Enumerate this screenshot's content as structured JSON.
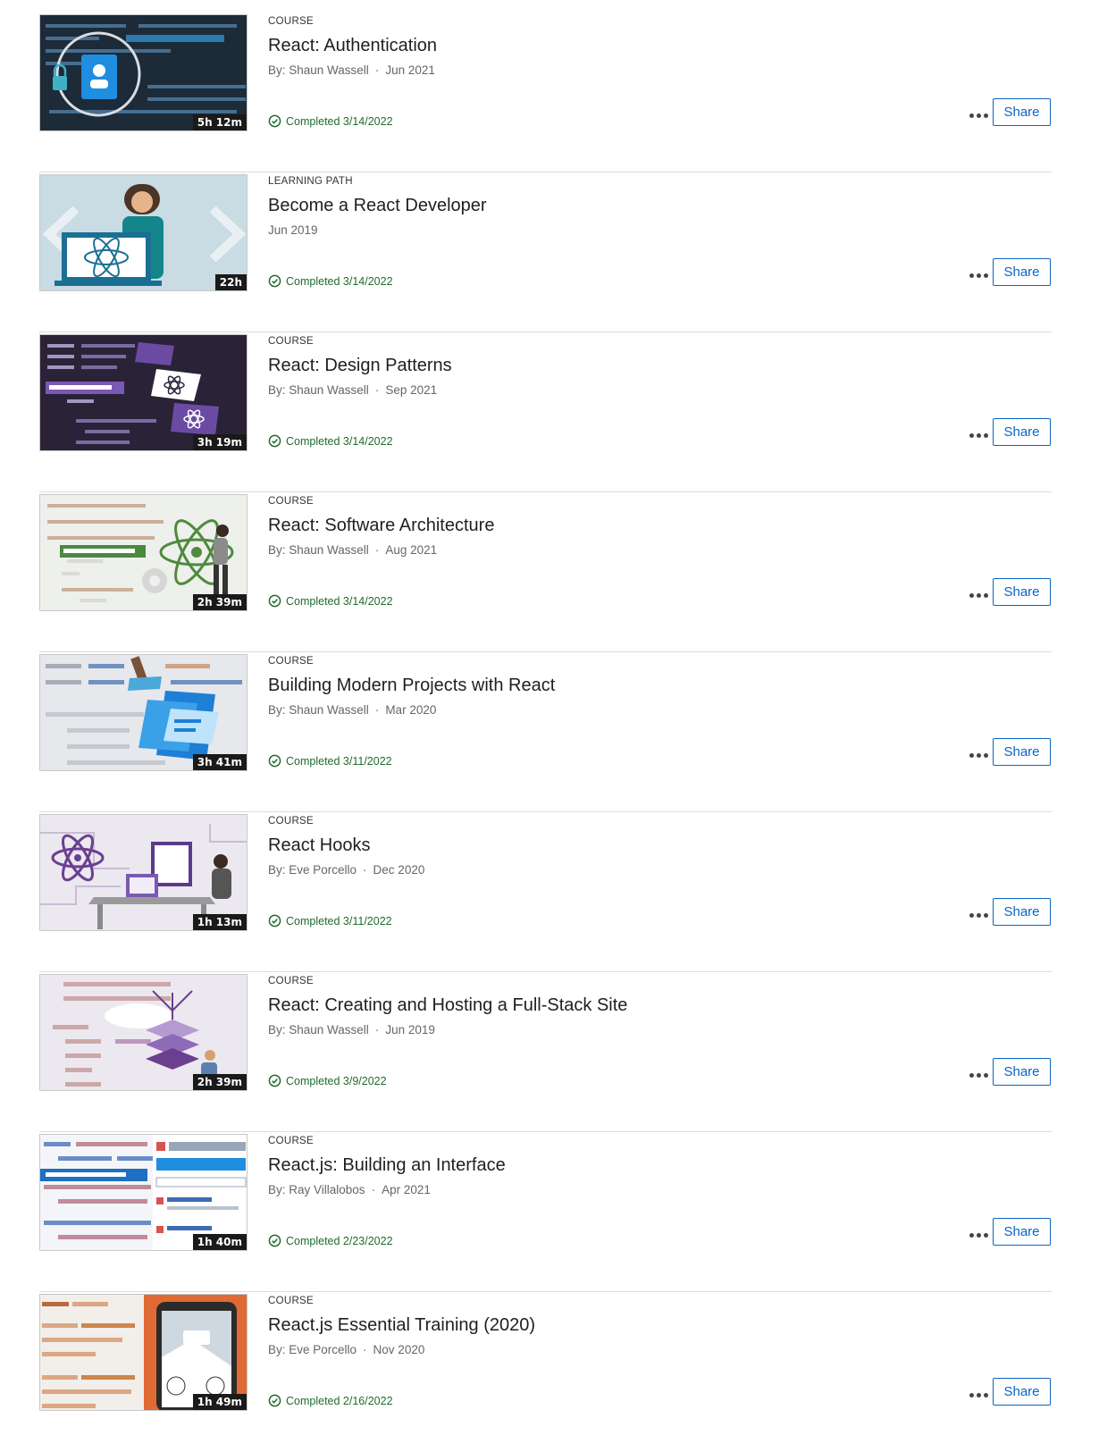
{
  "colors": {
    "completed": "#1f6b2e",
    "share_border": "#0a66c2",
    "duration_bg": "#1a1a1a"
  },
  "icons": {
    "completed": "check-circle-icon",
    "more": "more-options-icon"
  },
  "items": [
    {
      "type": "COURSE",
      "title": "React: Authentication",
      "author": "By: Shaun Wassell",
      "date": "Jun 2021",
      "duration": "5h 12m",
      "completed": "Completed 3/14/2022",
      "share": "Share"
    },
    {
      "type": "LEARNING PATH",
      "title": "Become a React Developer",
      "author": "",
      "date": "Jun 2019",
      "duration": "22h",
      "completed": "Completed 3/14/2022",
      "share": "Share"
    },
    {
      "type": "COURSE",
      "title": "React: Design Patterns",
      "author": "By: Shaun Wassell",
      "date": "Sep 2021",
      "duration": "3h 19m",
      "completed": "Completed 3/14/2022",
      "share": "Share"
    },
    {
      "type": "COURSE",
      "title": "React: Software Architecture",
      "author": "By: Shaun Wassell",
      "date": "Aug 2021",
      "duration": "2h 39m",
      "completed": "Completed 3/14/2022",
      "share": "Share"
    },
    {
      "type": "COURSE",
      "title": "Building Modern Projects with React",
      "author": "By: Shaun Wassell",
      "date": "Mar 2020",
      "duration": "3h 41m",
      "completed": "Completed 3/11/2022",
      "share": "Share"
    },
    {
      "type": "COURSE",
      "title": "React Hooks",
      "author": "By: Eve Porcello",
      "date": "Dec 2020",
      "duration": "1h 13m",
      "completed": "Completed 3/11/2022",
      "share": "Share"
    },
    {
      "type": "COURSE",
      "title": "React: Creating and Hosting a Full-Stack Site",
      "author": "By: Shaun Wassell",
      "date": "Jun 2019",
      "duration": "2h 39m",
      "completed": "Completed 3/9/2022",
      "share": "Share"
    },
    {
      "type": "COURSE",
      "title": "React.js: Building an Interface",
      "author": "By: Ray Villalobos",
      "date": "Apr 2021",
      "duration": "1h 40m",
      "completed": "Completed 2/23/2022",
      "share": "Share"
    },
    {
      "type": "COURSE",
      "title": "React.js Essential Training (2020)",
      "author": "By: Eve Porcello",
      "date": "Nov 2020",
      "duration": "1h 49m",
      "completed": "Completed 2/16/2022",
      "share": "Share"
    }
  ]
}
